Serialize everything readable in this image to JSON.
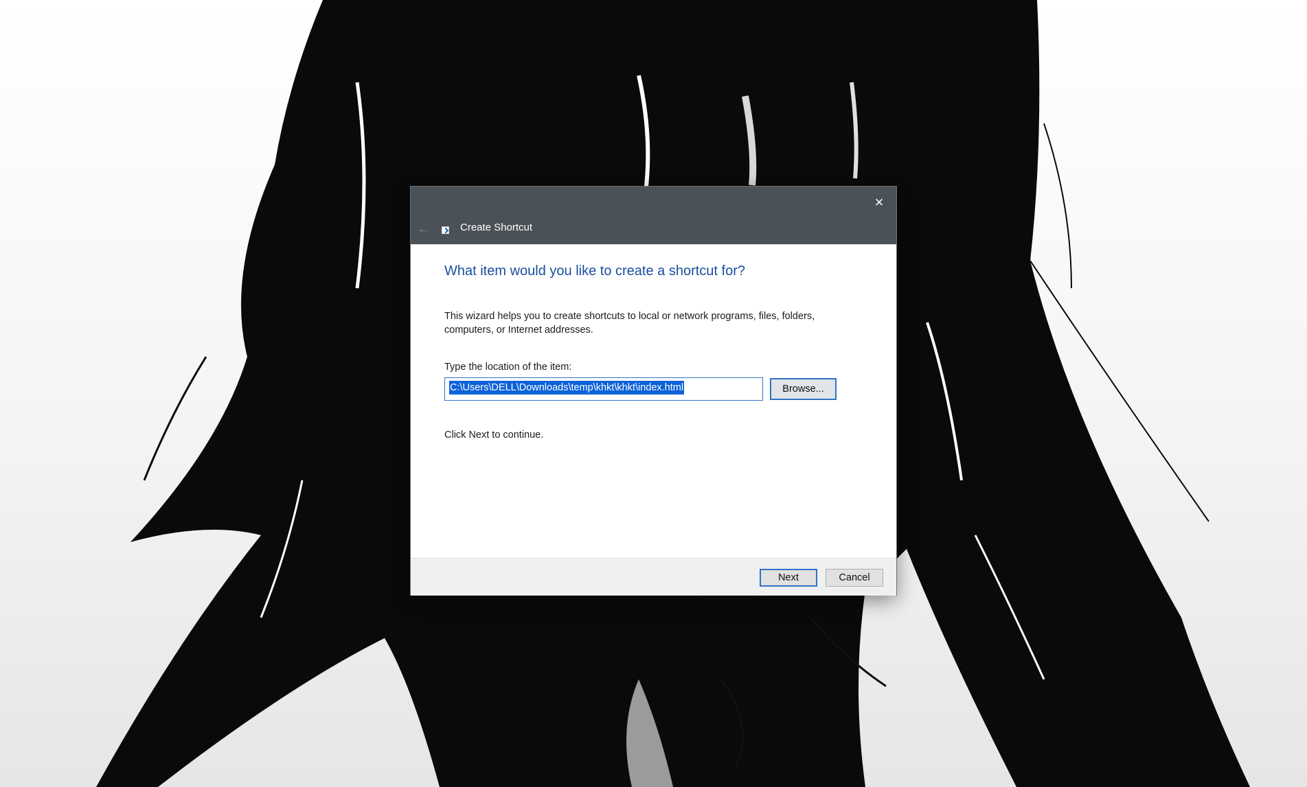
{
  "dialog": {
    "title": "Create Shortcut",
    "close_icon": "×",
    "back_icon": "←",
    "heading": "What item would you like to create a shortcut for?",
    "description": "This wizard helps you to create shortcuts to local or network programs, files, folders, computers, or Internet addresses.",
    "location_label": "Type the location of the item:",
    "location_value": "C:\\Users\\DELL\\Downloads\\temp\\khkt\\khkt\\index.html",
    "browse_label": "Browse...",
    "continue_text": "Click Next to continue.",
    "next_label": "Next",
    "cancel_label": "Cancel"
  },
  "colors": {
    "titlebar": "#4a5157",
    "heading": "#1a4d9e",
    "accent": "#2f72c7",
    "selection": "#0d62d8"
  },
  "icons": [
    "close-icon",
    "back-arrow-icon",
    "shortcut-icon"
  ]
}
